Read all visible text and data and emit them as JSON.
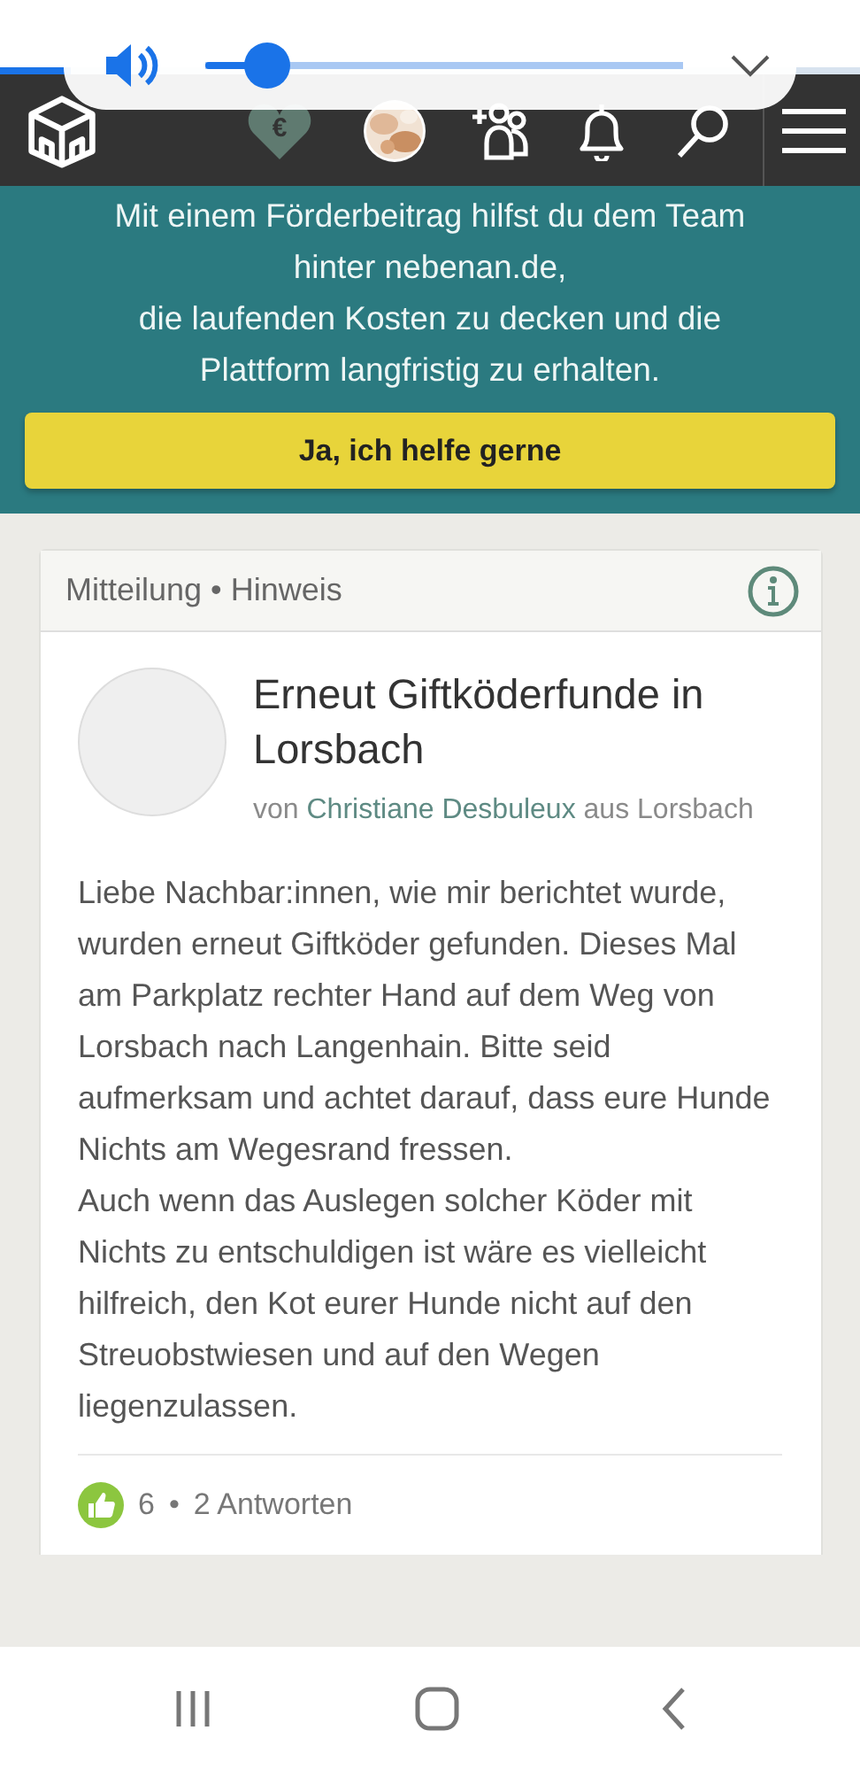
{
  "volume_popup": {
    "level": 0.13
  },
  "header": {
    "donate_badge": "€"
  },
  "banner": {
    "lines": [
      "Mit einem Förderbeitrag hilfst du dem Team",
      "hinter nebenan.de,",
      "die laufenden Kosten zu decken und die",
      "Plattform langfristig zu erhalten."
    ],
    "button": "Ja, ich helfe gerne"
  },
  "post": {
    "category": "Mitteilung • Hinweis",
    "title": "Erneut Giftköderfunde in Lorsbach",
    "by_prefix": "von",
    "author": "Christiane Desbuleux",
    "by_suffix": "aus Lorsbach",
    "paragraphs": [
      "Liebe Nachbar:innen, wie mir berichtet wurde, wurden erneut Giftköder gefunden. Dieses Mal am Parkplatz rechter Hand auf dem Weg von Lorsbach nach Langenhain. Bitte seid aufmerksam und achtet darauf, dass eure Hunde Nichts am Wegesrand fressen.",
      "Auch wenn das Auslegen solcher Köder mit Nichts zu entschuldigen ist wäre es vielleicht hilfreich, den Kot eurer Hunde nicht auf den Streuobstwiesen und auf den Wegen liegenzulassen."
    ],
    "likes": "6",
    "separator": "•",
    "replies": "2 Antworten"
  }
}
